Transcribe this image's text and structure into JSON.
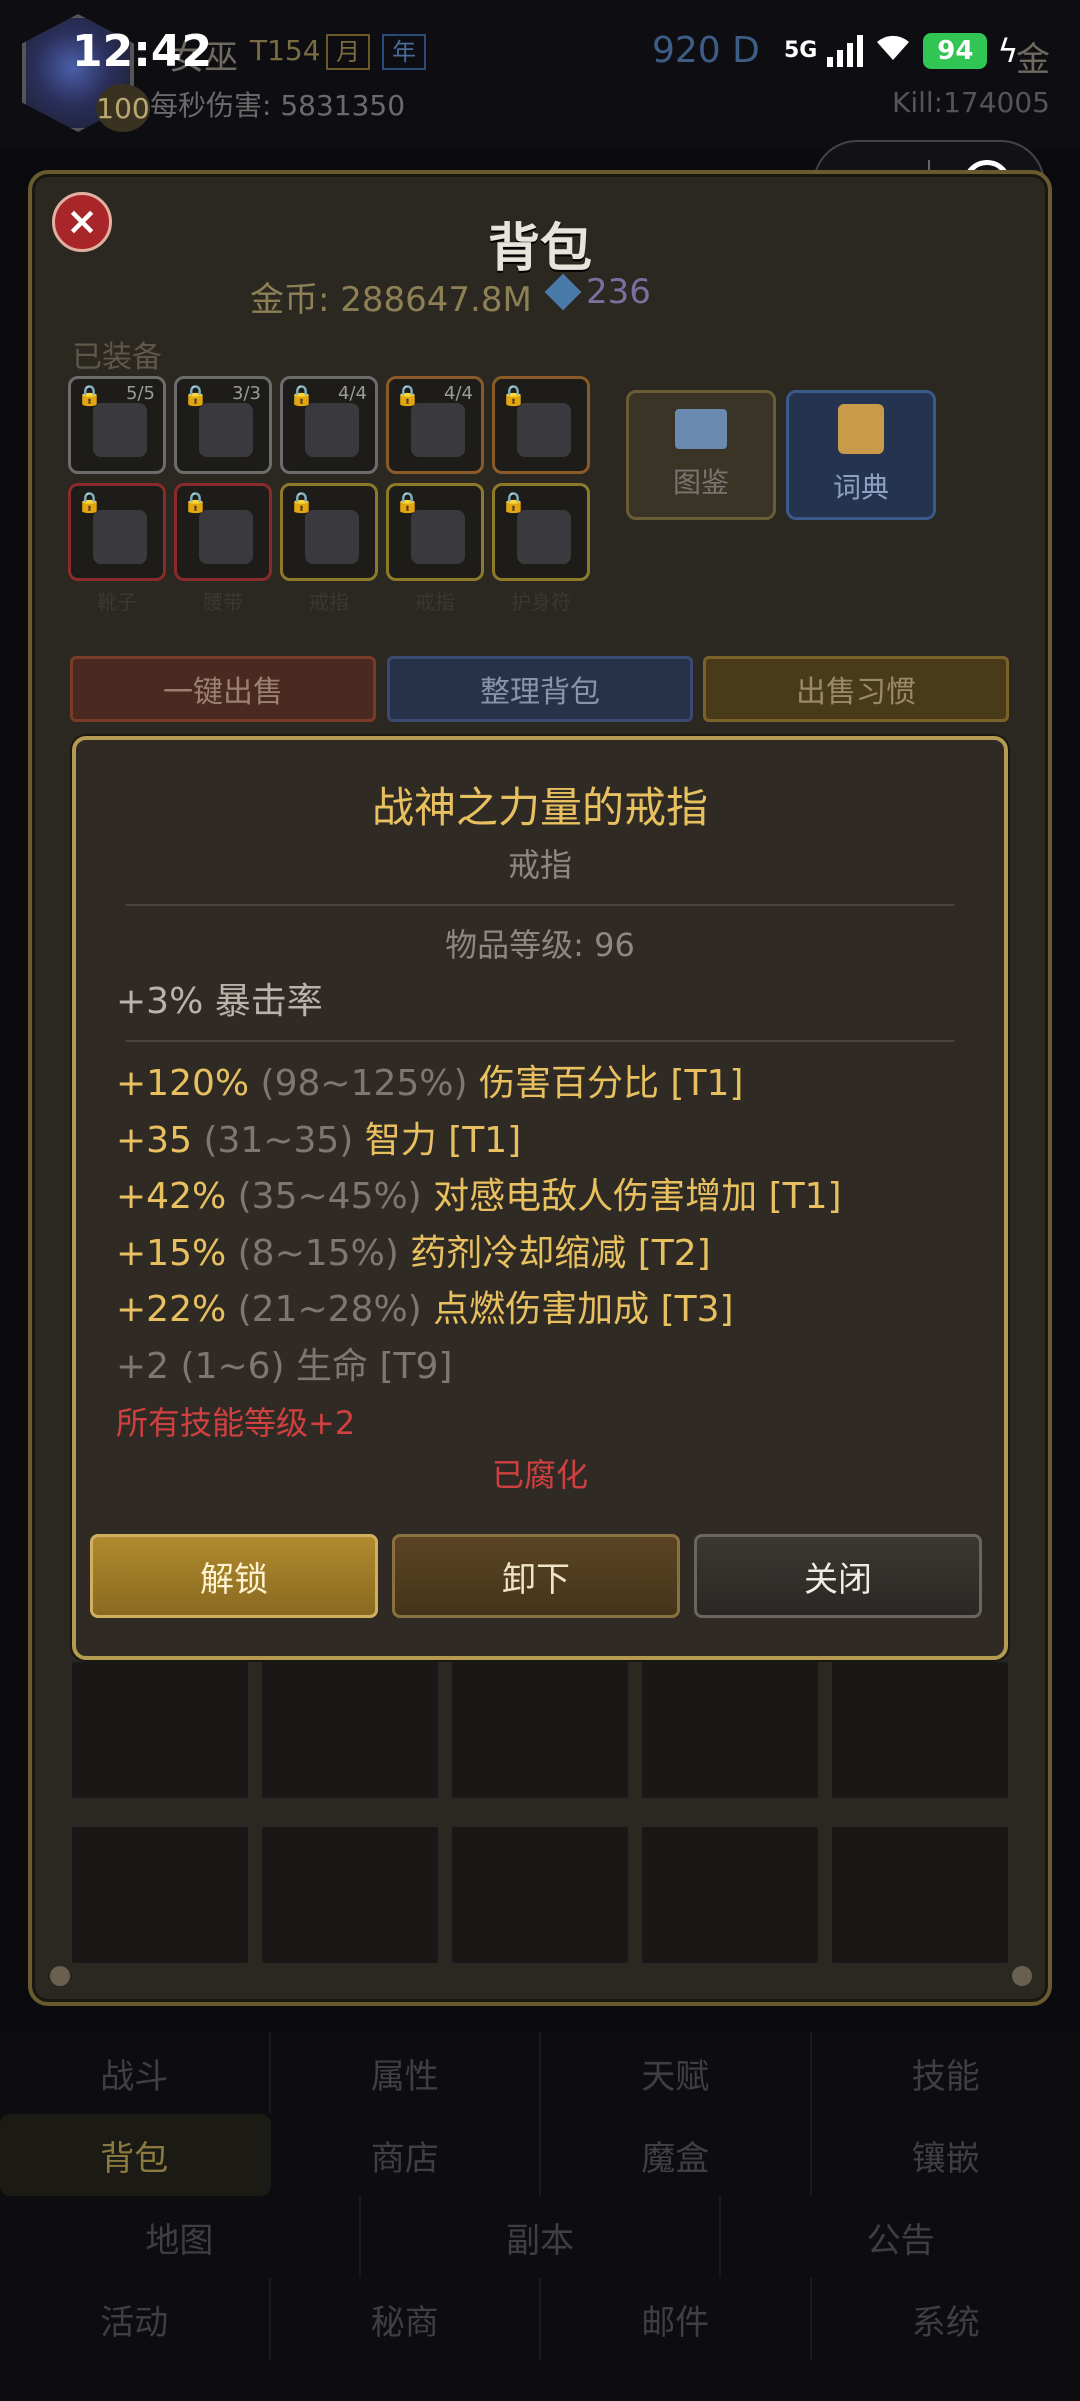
{
  "status_bar": {
    "time": "12:42",
    "network": "5G",
    "battery": "94"
  },
  "header": {
    "class_name": "女巫",
    "tier": "T154",
    "tag_month": "月",
    "tag_year": "年",
    "level": "100",
    "dps": "每秒伤害: 5831350",
    "currency": "920 D",
    "gold_suffix": "金",
    "kill": "Kill:174005"
  },
  "capsule": {
    "more": "•••"
  },
  "backpack": {
    "title": "背包",
    "gold": "金币: 288647.8M",
    "gems": "236",
    "equipped_label": "已装备",
    "slots": [
      {
        "count": "5/5",
        "color": "gray"
      },
      {
        "count": "3/3",
        "color": "gray"
      },
      {
        "count": "4/4",
        "color": "gray"
      },
      {
        "count": "4/4",
        "color": "orange"
      },
      {
        "count": "",
        "color": "orange"
      },
      {
        "count": "",
        "color": "red"
      },
      {
        "count": "",
        "color": "red"
      },
      {
        "count": "",
        "color": "gold"
      },
      {
        "count": "",
        "color": "gold"
      },
      {
        "count": "",
        "color": "gold"
      }
    ],
    "slot_captions": [
      "靴子",
      "腰带",
      "戒指",
      "戒指",
      "护身符"
    ],
    "atlas_label": "图鉴",
    "dict_label": "词典",
    "sell_all": "一键出售",
    "sort_bag": "整理背包",
    "sell_habit": "出售习惯"
  },
  "item": {
    "name": "战神之力量的戒指",
    "type": "戒指",
    "item_level": "物品等级: 96",
    "implicit": "+3% 暴击率",
    "affixes": [
      {
        "value": "+120%",
        "range": "(98~125%)",
        "name": "伤害百分比 [T1]",
        "dim": false
      },
      {
        "value": "+35",
        "range": "(31~35)",
        "name": "智力 [T1]",
        "dim": false
      },
      {
        "value": "+42%",
        "range": "(35~45%)",
        "name": "对感电敌人伤害增加 [T1]",
        "dim": false
      },
      {
        "value": "+15%",
        "range": "(8~15%)",
        "name": "药剂冷却缩减 [T2]",
        "dim": false
      },
      {
        "value": "+22%",
        "range": "(21~28%)",
        "name": "点燃伤害加成 [T3]",
        "dim": false
      },
      {
        "value": "+2",
        "range": "(1~6)",
        "name": "生命 [T9]",
        "dim": true
      }
    ],
    "special": "所有技能等级+2",
    "corrupted": "已腐化",
    "btn_unlock": "解锁",
    "btn_unequip": "卸下",
    "btn_close": "关闭"
  },
  "nav": {
    "row1": [
      "战斗",
      "属性",
      "天赋",
      "技能"
    ],
    "row2": [
      "背包",
      "商店",
      "魔盒",
      "镶嵌"
    ],
    "row3": [
      "地图",
      "副本",
      "公告"
    ],
    "row4": [
      "活动",
      "秘商",
      "邮件",
      "系统"
    ]
  }
}
